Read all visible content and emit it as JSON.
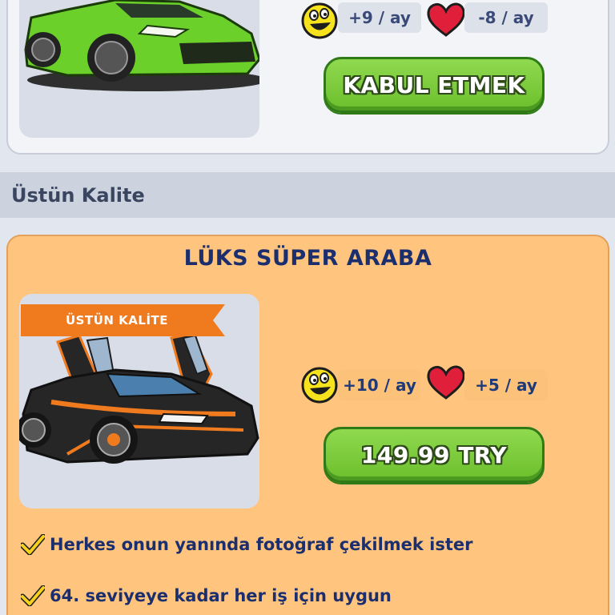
{
  "top_card": {
    "stats": {
      "happiness": {
        "icon": "smiley-face-icon",
        "value": "+9 / ay"
      },
      "love": {
        "icon": "heart-icon",
        "value": "-8 / ay"
      }
    },
    "button_label": "KABUL ETMEK",
    "car_color": "#6bd12a"
  },
  "section": {
    "title": "Üstün Kalite"
  },
  "offer_card": {
    "title": "LÜKS SÜPER ARABA",
    "ribbon": "ÜSTÜN KALİTE",
    "stats": {
      "happiness": {
        "icon": "smiley-face-icon",
        "value": "+10 / ay"
      },
      "love": {
        "icon": "heart-icon",
        "value": "+5 / ay"
      }
    },
    "price_label": "149.99 TRY",
    "features": [
      "Herkes onun yanında fotoğraf çekilmek ister",
      "64. seviyeye kadar her iş için uygun"
    ],
    "car_color": "#262626",
    "accent_color": "#f07a1e"
  },
  "colors": {
    "button_green": "#7acc38",
    "card_orange": "#ffc57e",
    "title_navy": "#1b2e6e",
    "heart_red": "#e0203a",
    "smiley_yellow": "#f7e21e"
  }
}
